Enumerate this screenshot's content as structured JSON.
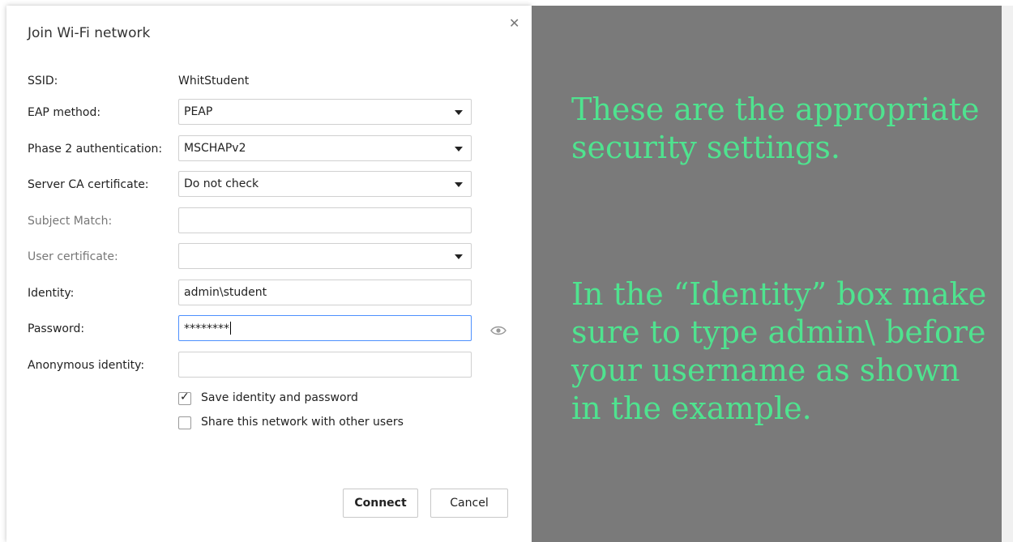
{
  "dialog": {
    "title": "Join Wi-Fi network",
    "close_icon": "close-icon"
  },
  "form": {
    "ssid_label": "SSID:",
    "ssid_value": "WhitStudent",
    "eap_label": "EAP method:",
    "eap_value": "PEAP",
    "phase2_label": "Phase 2 authentication:",
    "phase2_value": "MSCHAPv2",
    "server_ca_label": "Server CA certificate:",
    "server_ca_value": "Do not check",
    "subject_label": "Subject Match:",
    "subject_value": "",
    "user_cert_label": "User certificate:",
    "user_cert_value": "",
    "identity_label": "Identity:",
    "identity_value": "admin\\student",
    "password_label": "Password:",
    "password_value": "********",
    "anon_label": "Anonymous identity:",
    "anon_value": "",
    "save_identity_label": "Save identity and password",
    "save_identity_checked": true,
    "share_label": "Share this network with other users",
    "share_checked": false
  },
  "buttons": {
    "connect": "Connect",
    "cancel": "Cancel"
  },
  "annotation": {
    "note1": "These are the appropriate security settings.",
    "note2": "In the “Identity” box make sure to type admin\\ before your username as shown in the example."
  },
  "colors": {
    "annotation_text": "#4fe38f",
    "overlay": "#7a7a7a",
    "focus_border": "#4d90fe"
  }
}
